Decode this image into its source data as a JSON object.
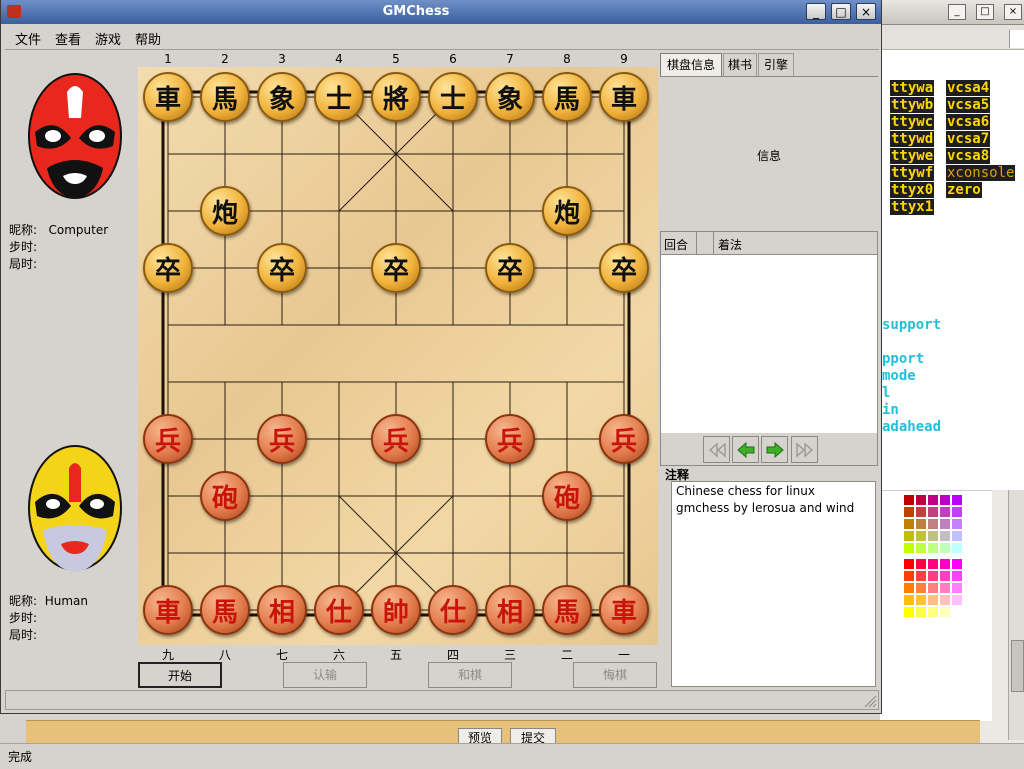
{
  "window": {
    "title": "GMChess",
    "controls": [
      "_",
      "□",
      "×"
    ]
  },
  "menu": [
    "文件",
    "查看",
    "游戏",
    "帮助"
  ],
  "files_top": [
    "1",
    "2",
    "3",
    "4",
    "5",
    "6",
    "7",
    "8",
    "9"
  ],
  "files_bottom": [
    "九",
    "八",
    "七",
    "六",
    "五",
    "四",
    "三",
    "二",
    "一"
  ],
  "players": {
    "top": {
      "nick_label": "昵称:",
      "nick": "Computer",
      "step_label": "步时:",
      "game_label": "局时:"
    },
    "bottom": {
      "nick_label": "昵称:",
      "nick": "Human",
      "step_label": "步时:",
      "game_label": "局时:"
    }
  },
  "pieces": [
    {
      "c": 0,
      "r": 0,
      "ch": "車",
      "side": "black"
    },
    {
      "c": 1,
      "r": 0,
      "ch": "馬",
      "side": "black"
    },
    {
      "c": 2,
      "r": 0,
      "ch": "象",
      "side": "black"
    },
    {
      "c": 3,
      "r": 0,
      "ch": "士",
      "side": "black"
    },
    {
      "c": 4,
      "r": 0,
      "ch": "將",
      "side": "black"
    },
    {
      "c": 5,
      "r": 0,
      "ch": "士",
      "side": "black"
    },
    {
      "c": 6,
      "r": 0,
      "ch": "象",
      "side": "black"
    },
    {
      "c": 7,
      "r": 0,
      "ch": "馬",
      "side": "black"
    },
    {
      "c": 8,
      "r": 0,
      "ch": "車",
      "side": "black"
    },
    {
      "c": 1,
      "r": 2,
      "ch": "炮",
      "side": "black"
    },
    {
      "c": 7,
      "r": 2,
      "ch": "炮",
      "side": "black"
    },
    {
      "c": 0,
      "r": 3,
      "ch": "卒",
      "side": "black"
    },
    {
      "c": 2,
      "r": 3,
      "ch": "卒",
      "side": "black"
    },
    {
      "c": 4,
      "r": 3,
      "ch": "卒",
      "side": "black"
    },
    {
      "c": 6,
      "r": 3,
      "ch": "卒",
      "side": "black"
    },
    {
      "c": 8,
      "r": 3,
      "ch": "卒",
      "side": "black"
    },
    {
      "c": 0,
      "r": 6,
      "ch": "兵",
      "side": "red"
    },
    {
      "c": 2,
      "r": 6,
      "ch": "兵",
      "side": "red"
    },
    {
      "c": 4,
      "r": 6,
      "ch": "兵",
      "side": "red"
    },
    {
      "c": 6,
      "r": 6,
      "ch": "兵",
      "side": "red"
    },
    {
      "c": 8,
      "r": 6,
      "ch": "兵",
      "side": "red"
    },
    {
      "c": 1,
      "r": 7,
      "ch": "砲",
      "side": "red"
    },
    {
      "c": 7,
      "r": 7,
      "ch": "砲",
      "side": "red"
    },
    {
      "c": 0,
      "r": 9,
      "ch": "車",
      "side": "red"
    },
    {
      "c": 1,
      "r": 9,
      "ch": "馬",
      "side": "red"
    },
    {
      "c": 2,
      "r": 9,
      "ch": "相",
      "side": "red"
    },
    {
      "c": 3,
      "r": 9,
      "ch": "仕",
      "side": "red"
    },
    {
      "c": 4,
      "r": 9,
      "ch": "帥",
      "side": "red"
    },
    {
      "c": 5,
      "r": 9,
      "ch": "仕",
      "side": "red"
    },
    {
      "c": 6,
      "r": 9,
      "ch": "相",
      "side": "red"
    },
    {
      "c": 7,
      "r": 9,
      "ch": "馬",
      "side": "red"
    },
    {
      "c": 8,
      "r": 9,
      "ch": "車",
      "side": "red"
    }
  ],
  "buttons": {
    "start": "开始",
    "resign": "认输",
    "draw": "和棋",
    "undo": "悔棋"
  },
  "tabs": [
    "棋盘信息",
    "棋书",
    "引擎"
  ],
  "info": {
    "text": "信息"
  },
  "moves_header": {
    "round": "回合",
    "note": "着法"
  },
  "comment": {
    "label": "注释",
    "lines": [
      "Chinese chess for linux",
      "gmchess by lerosua and wind"
    ]
  },
  "background": {
    "terminal_col1": [
      "ttywa",
      "ttywb",
      "ttywc",
      "ttywd",
      "ttywe",
      "ttywf",
      "ttyx0",
      "ttyx1"
    ],
    "terminal_col2": [
      "vcsa4",
      "vcsa5",
      "vcsa6",
      "vcsa7",
      "vcsa8",
      "xconsole",
      "zero"
    ],
    "terminal_cyan": [
      "support",
      "",
      "pport",
      "mode",
      "l",
      "in",
      "adahead"
    ],
    "web_buttons": [
      "预览",
      "提交"
    ],
    "status": "完成",
    "window_controls": [
      "_",
      "□",
      "×"
    ]
  },
  "colors": {
    "titlebar": "#4a6aa8",
    "board": "#ecd09c",
    "black_piece": "#f0b23a",
    "red_piece": "#e27b4c"
  }
}
